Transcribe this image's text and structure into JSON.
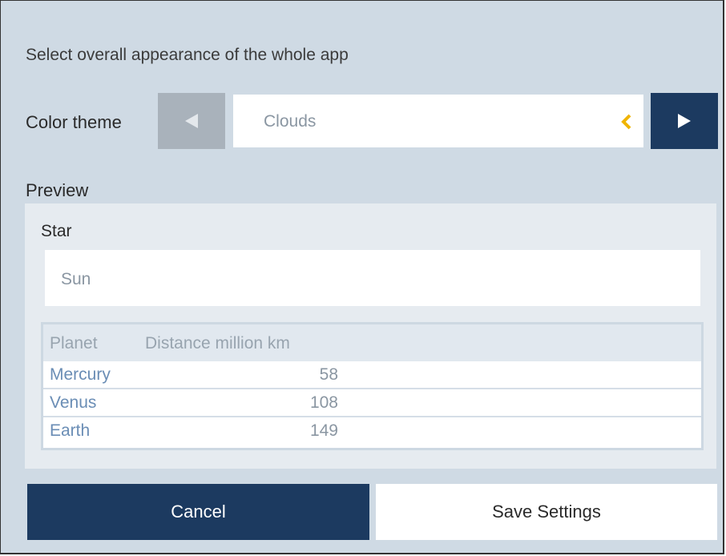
{
  "settings": {
    "description": "Select overall appearance of the whole app",
    "color_theme_label": "Color theme",
    "color_theme_value": "Clouds",
    "prev_icon": "triangle-left-icon",
    "next_icon": "triangle-right-icon",
    "chevron_icon": "chevron-left-icon"
  },
  "preview": {
    "label": "Preview",
    "star_label": "Star",
    "star_value": "Sun",
    "table": {
      "headers": [
        "Planet",
        "Distance million km"
      ],
      "rows": [
        {
          "planet": "Mercury",
          "distance": "58"
        },
        {
          "planet": "Venus",
          "distance": "108"
        },
        {
          "planet": "Earth",
          "distance": "149"
        }
      ]
    }
  },
  "actions": {
    "cancel_label": "Cancel",
    "save_label": "Save Settings"
  },
  "colors": {
    "dialog_background": "#cfdae4",
    "accent_dark_blue": "#1c3a60",
    "disabled_gray": "#a9b2bb",
    "chevron_yellow": "#f0b400",
    "link_blue": "#6a8db5"
  }
}
